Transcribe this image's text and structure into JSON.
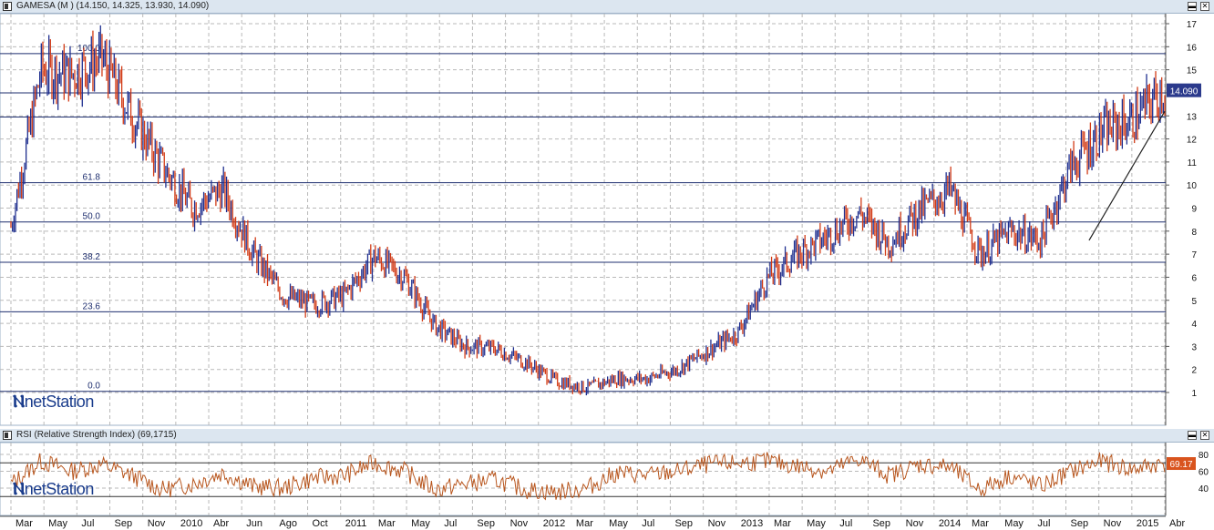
{
  "price_panel": {
    "title": "GAMESA (M ) (14.150, 14.325, 13.930, 14.090)",
    "last_price_label": "14.090",
    "minimize_icon": "minimize-icon",
    "close_icon": "close-icon"
  },
  "rsi_panel": {
    "title": "RSI (Relative Strength Index) (69,1715)",
    "last_value_label": "69.17"
  },
  "logo": {
    "text": "netStation",
    "icon": "n-logo-icon"
  },
  "colors": {
    "up": "#1f2f8f",
    "down": "#d23b16",
    "rsi": "#b8561e",
    "level": "#1f2f6f",
    "grid": "#b9b9b9",
    "label_bg": "#2b3a8c",
    "rsi_label_bg": "#d9541e"
  },
  "chart_data": [
    {
      "type": "line",
      "name": "GAMESA price",
      "ylim": [
        0,
        17
      ],
      "y_ticks": [
        1,
        2,
        3,
        4,
        5,
        6,
        7,
        8,
        9,
        10,
        11,
        12,
        13,
        14,
        15,
        16,
        17
      ],
      "x_tick_labels": [
        "Mar",
        "May",
        "Jul",
        "Sep",
        "Nov",
        "2010",
        "Abr",
        "Jun",
        "Ago",
        "Oct",
        "2011",
        "Mar",
        "May",
        "Jul",
        "Sep",
        "Nov",
        "2012",
        "Mar",
        "May",
        "Jul",
        "Sep",
        "Nov",
        "2013",
        "Mar",
        "May",
        "Jul",
        "Sep",
        "Nov",
        "2014",
        "Mar",
        "May",
        "Jul",
        "Sep",
        "Nov",
        "2015",
        "Abr"
      ],
      "x": [
        0,
        2,
        4,
        6,
        8,
        10,
        12,
        14,
        16,
        18,
        20,
        22,
        24,
        26,
        28,
        30,
        32,
        34,
        36,
        38,
        40,
        42,
        44,
        46,
        48,
        50,
        52,
        54,
        56,
        58,
        60,
        62,
        64,
        66,
        68,
        70,
        72,
        74,
        76
      ],
      "x_units": "months since Mar 2009",
      "values": [
        8.2,
        15.0,
        14.8,
        15.5,
        13.0,
        10.8,
        9.0,
        9.8,
        7.0,
        5.2,
        4.8,
        5.2,
        6.9,
        6.0,
        3.9,
        3.0,
        2.9,
        2.3,
        1.5,
        1.2,
        1.6,
        1.6,
        2.0,
        2.8,
        3.6,
        6.0,
        7.0,
        7.8,
        8.8,
        7.5,
        8.9,
        9.8,
        7.0,
        8.0,
        7.6,
        10.8,
        12.3,
        12.8,
        14.09
      ],
      "fib_levels": [
        {
          "label": "100.0",
          "value": 15.7
        },
        {
          "label": "61.8",
          "value": 10.1
        },
        {
          "label": "50.0",
          "value": 8.4
        },
        {
          "label": "38.2",
          "value": 6.65
        },
        {
          "label": "23.6",
          "value": 4.5
        },
        {
          "label": "0.0",
          "value": 1.05
        }
      ],
      "horizontal_lines": [
        14.0,
        12.95
      ],
      "trendline": {
        "from": [
          71.2,
          7.6
        ],
        "to": [
          76.2,
          13.2
        ]
      }
    },
    {
      "type": "line",
      "name": "RSI",
      "ylim": [
        20,
        90
      ],
      "y_ticks": [
        40,
        60,
        80
      ],
      "reference_lines": [
        70,
        30
      ],
      "x": [
        0,
        2,
        4,
        6,
        8,
        10,
        12,
        14,
        16,
        18,
        20,
        22,
        24,
        26,
        28,
        30,
        32,
        34,
        36,
        38,
        40,
        42,
        44,
        46,
        48,
        50,
        52,
        54,
        56,
        58,
        60,
        62,
        64,
        66,
        68,
        70,
        72,
        74,
        76
      ],
      "values": [
        45,
        72,
        60,
        68,
        55,
        38,
        45,
        58,
        42,
        40,
        52,
        55,
        70,
        60,
        38,
        45,
        50,
        38,
        35,
        40,
        58,
        55,
        60,
        68,
        70,
        72,
        66,
        60,
        75,
        55,
        68,
        65,
        38,
        55,
        42,
        60,
        72,
        62,
        69.17
      ]
    }
  ]
}
